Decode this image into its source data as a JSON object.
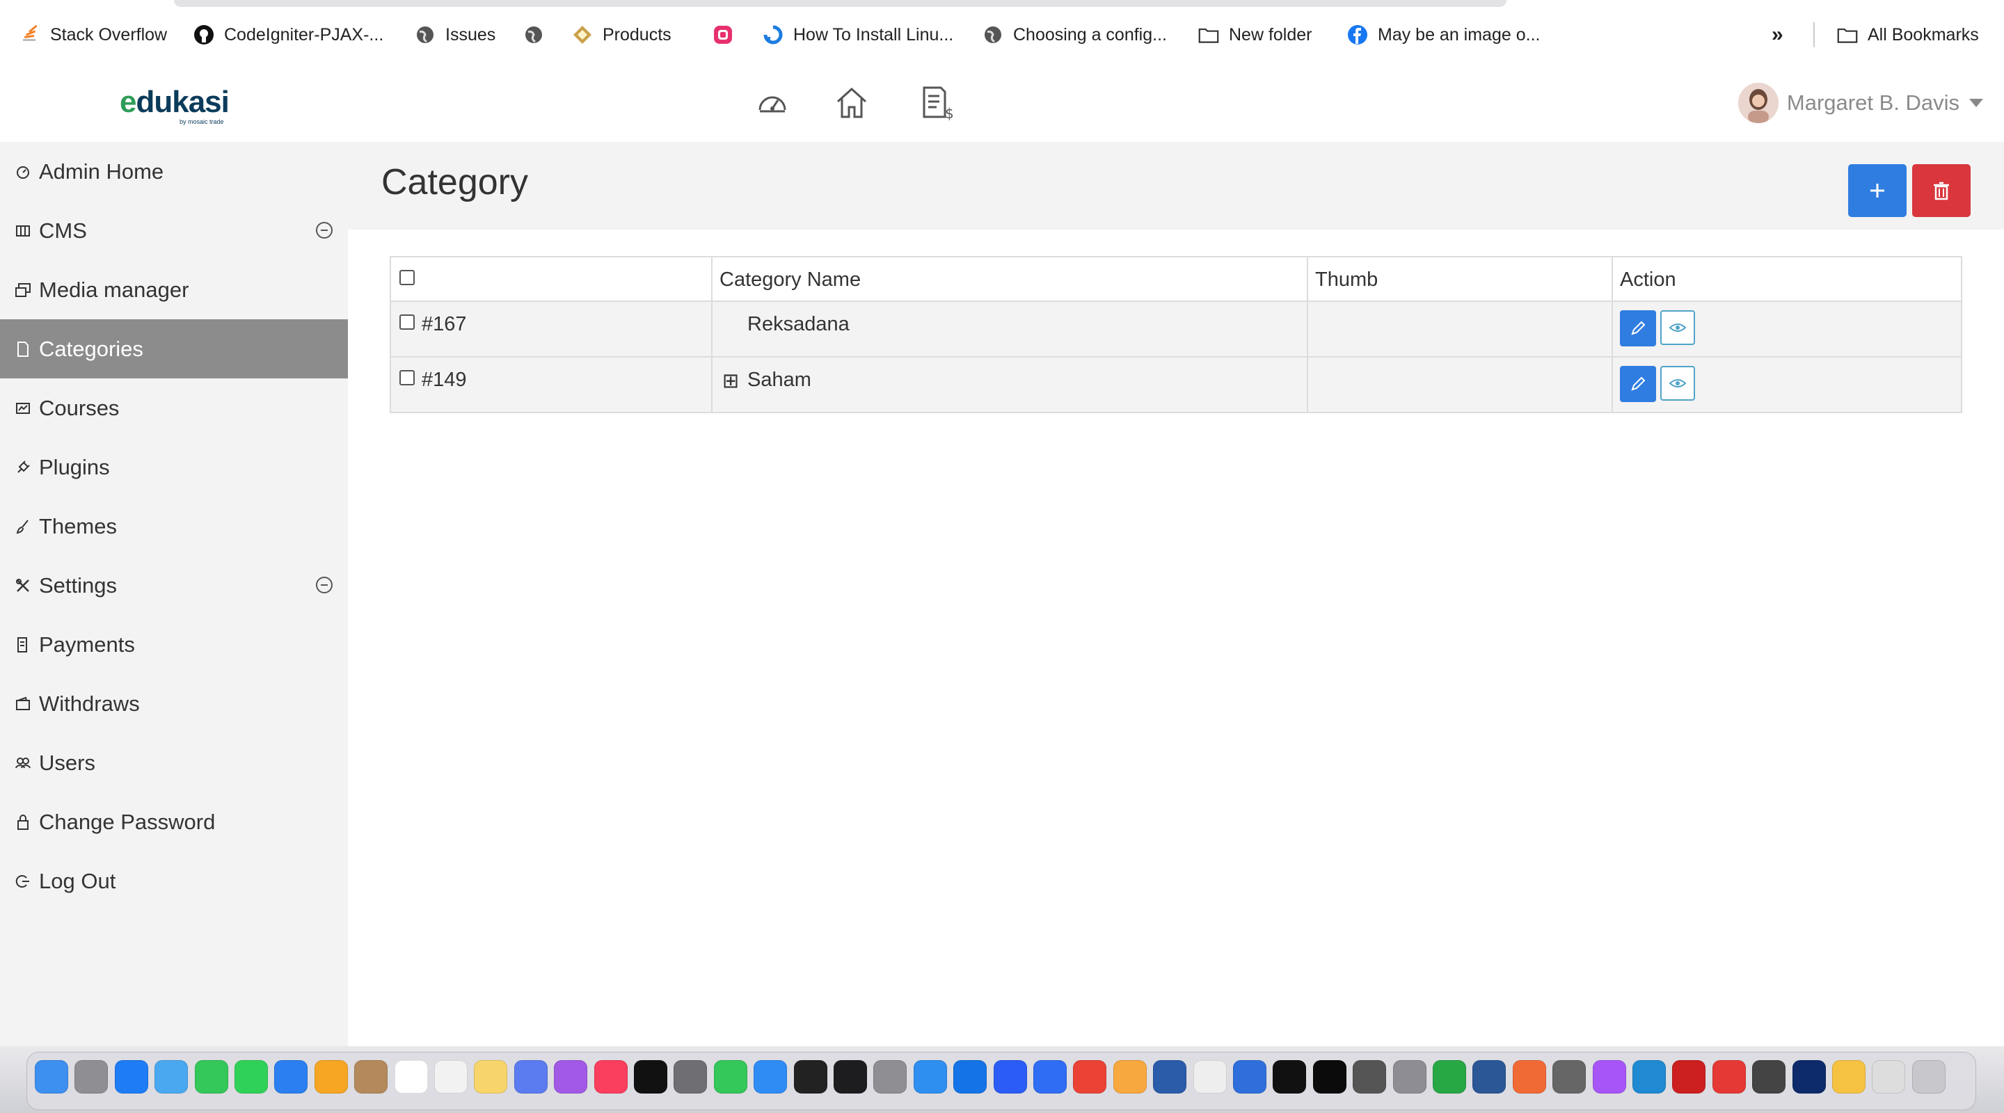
{
  "browser": {
    "bookmarks": [
      {
        "label": "Stack Overflow",
        "icon": "stackoverflow-icon"
      },
      {
        "label": "CodeIgniter-PJAX-...",
        "icon": "github-icon"
      },
      {
        "label": "Issues",
        "icon": "globe-icon"
      },
      {
        "label": "",
        "icon": "globe-icon"
      },
      {
        "label": "Products",
        "icon": "diamond-icon"
      },
      {
        "label": "",
        "icon": "app-icon"
      },
      {
        "label": "How To Install Linu...",
        "icon": "digitalocean-icon"
      },
      {
        "label": "Choosing a config...",
        "icon": "globe-icon"
      },
      {
        "label": "New folder",
        "icon": "folder-icon"
      },
      {
        "label": "May be an image o...",
        "icon": "facebook-icon"
      }
    ],
    "more_label": "»",
    "all_bookmarks_label": "All Bookmarks"
  },
  "header": {
    "logo_text": "edukasi",
    "logo_sub": "by mosaic trade",
    "icons": [
      "dashboard-icon",
      "home-icon",
      "invoice-icon"
    ],
    "user_name": "Margaret B. Davis"
  },
  "sidebar": {
    "items": [
      {
        "label": "Admin Home",
        "icon": "dashboard-icon"
      },
      {
        "label": "CMS",
        "icon": "cms-icon"
      },
      {
        "label": "Media manager",
        "icon": "media-icon"
      },
      {
        "label": "Categories",
        "icon": "file-icon"
      },
      {
        "label": "Courses",
        "icon": "courses-icon"
      },
      {
        "label": "Plugins",
        "icon": "plug-icon"
      },
      {
        "label": "Themes",
        "icon": "brush-icon"
      },
      {
        "label": "Settings",
        "icon": "tools-icon"
      },
      {
        "label": "Payments",
        "icon": "receipt-icon"
      },
      {
        "label": "Withdraws",
        "icon": "wallet-icon"
      },
      {
        "label": "Users",
        "icon": "users-icon"
      },
      {
        "label": "Change Password",
        "icon": "lock-icon"
      },
      {
        "label": "Log Out",
        "icon": "logout-icon"
      }
    ],
    "active": "Categories"
  },
  "main": {
    "title": "Category",
    "add_button_icon": "plus-icon",
    "delete_button_icon": "trash-icon",
    "table": {
      "headers": [
        "",
        "Category Name",
        "Thumb",
        "Action"
      ],
      "rows": [
        {
          "id": "#167",
          "name": "Reksadana",
          "expand": "",
          "thumb": ""
        },
        {
          "id": "#149",
          "name": "Saham",
          "expand": "⊞",
          "thumb": ""
        }
      ]
    }
  },
  "colors": {
    "primary": "#2f7de1",
    "danger": "#d9363e",
    "sidebar_active": "#8c8c8c",
    "logo": "#0b3b5a"
  }
}
